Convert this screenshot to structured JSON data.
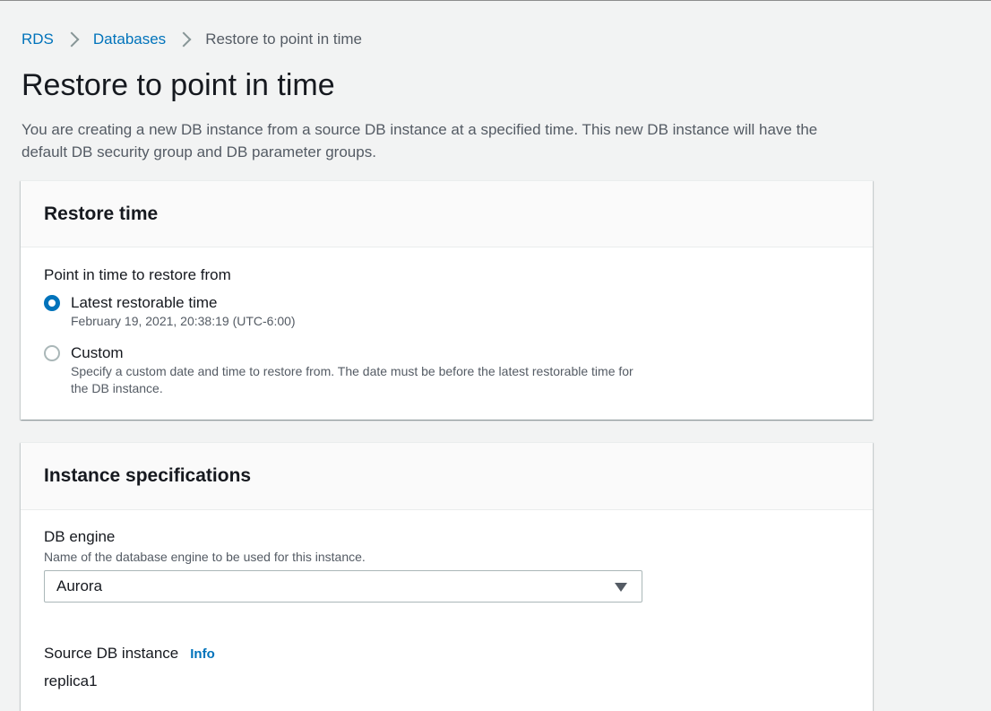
{
  "breadcrumb": {
    "items": [
      "RDS",
      "Databases"
    ],
    "current": "Restore to point in time"
  },
  "page": {
    "title": "Restore to point in time",
    "description": "You are creating a new DB instance from a source DB instance at a specified time. This new DB instance will have the default DB security group and DB parameter groups."
  },
  "restore_time": {
    "title": "Restore time",
    "field_label": "Point in time to restore from",
    "options": [
      {
        "label": "Latest restorable time",
        "description": "February 19, 2021, 20:38:19 (UTC-6:00)",
        "selected": true
      },
      {
        "label": "Custom",
        "description": "Specify a custom date and time to restore from. The date must be before the latest restorable time for the DB instance.",
        "selected": false
      }
    ]
  },
  "instance_specs": {
    "title": "Instance specifications",
    "db_engine": {
      "label": "DB engine",
      "description": "Name of the database engine to be used for this instance.",
      "value": "Aurora"
    },
    "source_instance": {
      "label": "Source DB instance",
      "info_label": "Info",
      "value": "replica1"
    }
  },
  "colors": {
    "link": "#0073bb",
    "background": "#f2f3f3",
    "panel_header": "#fafafa"
  }
}
